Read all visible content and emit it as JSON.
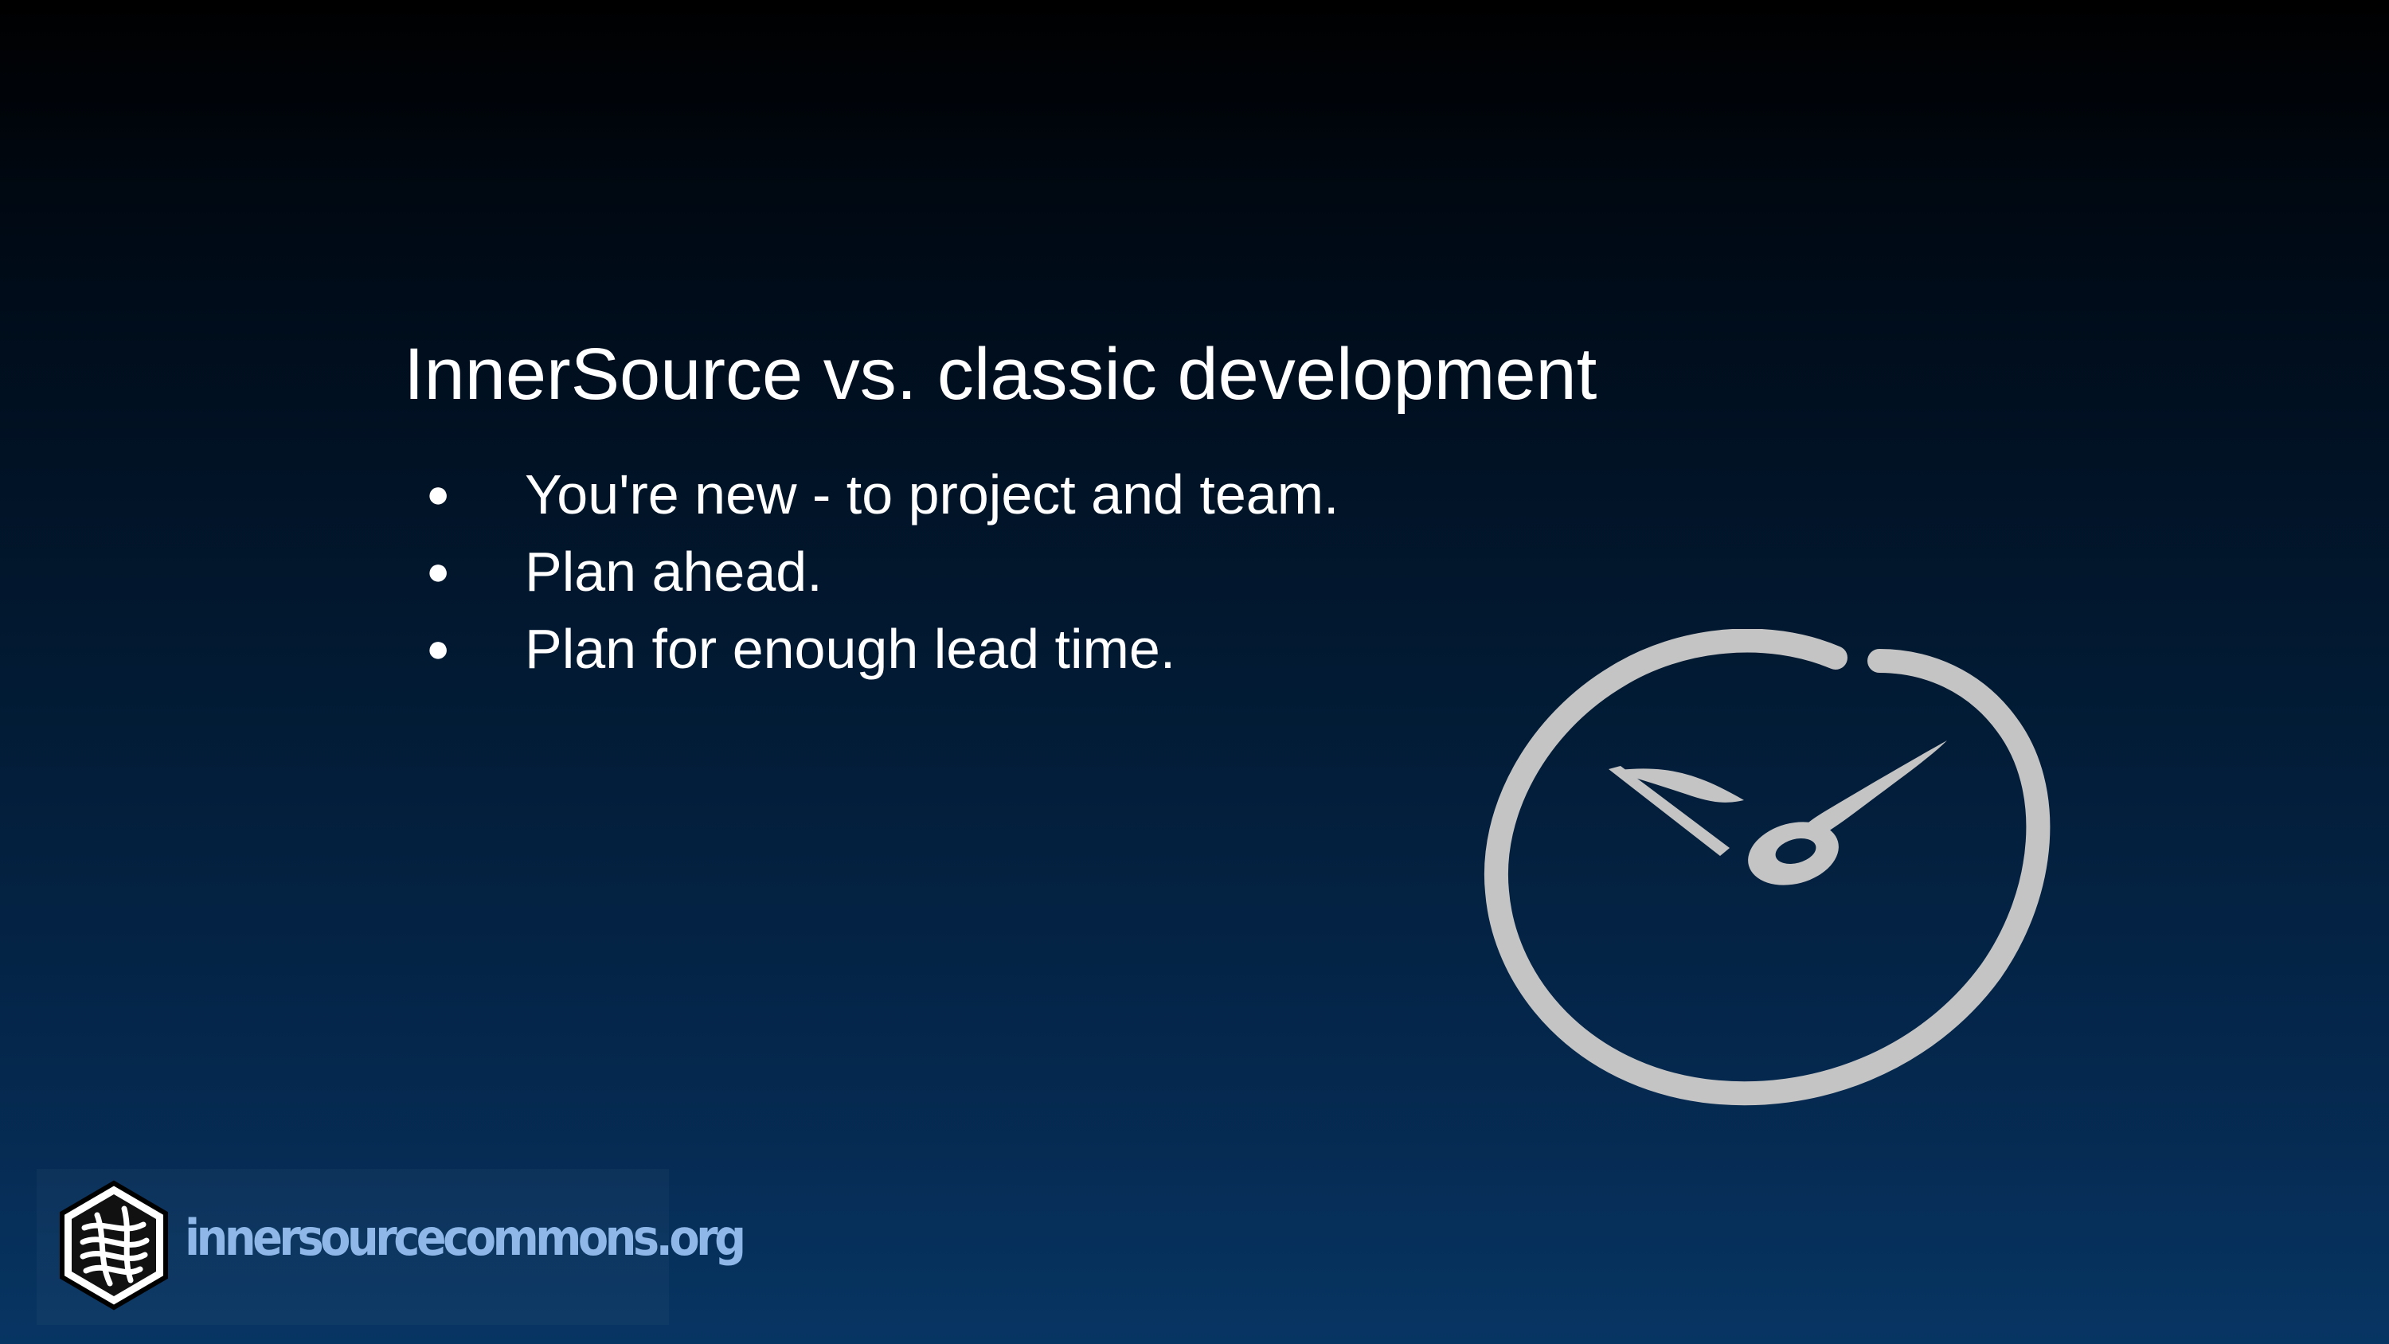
{
  "slide": {
    "title": "InnerSource vs. classic development",
    "bullets": [
      "You're new - to project and team.",
      "Plan ahead.",
      "Plan for enough lead time."
    ],
    "bullet_symbol": "●"
  },
  "footer": {
    "logo_text": "innersourcecommons.org",
    "logo_color": "#8fb8e8"
  },
  "graphics": {
    "clock_icon": "clock-icon",
    "clock_color": "#c4c4c4"
  },
  "colors": {
    "background_top": "#000000",
    "background_bottom": "#073563",
    "text": "#ffffff"
  }
}
